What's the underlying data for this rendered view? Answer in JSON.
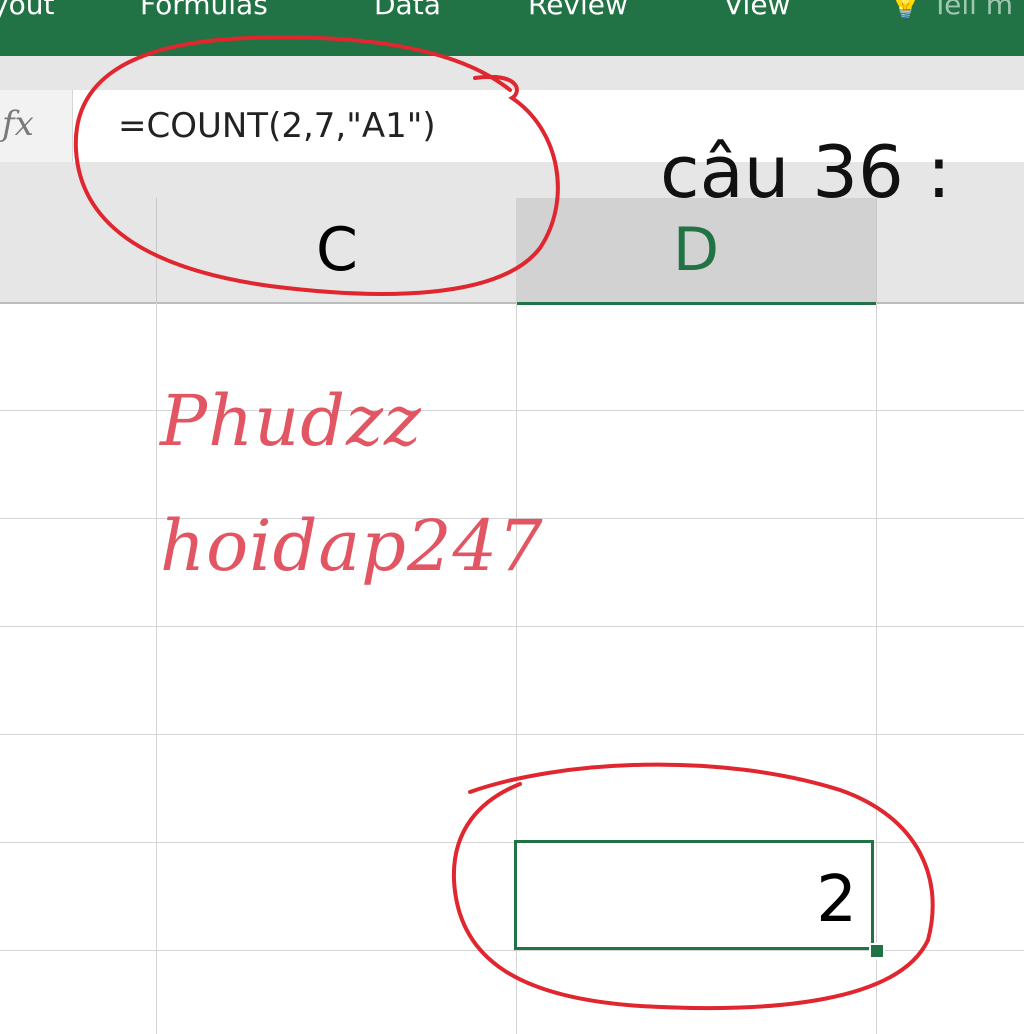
{
  "ribbon": {
    "tabs": [
      "yout",
      "Formulas",
      "Data",
      "Review",
      "View",
      "Tell m"
    ],
    "bg_color": "#217346"
  },
  "formula_bar": {
    "fx_label": "fx",
    "formula": "=COUNT(2,7,\"A1\")"
  },
  "column_headers": {
    "c": "C",
    "d": "D"
  },
  "annotation": {
    "question": "câu 36 :",
    "watermark_line1": "Phudzz",
    "watermark_line2": "hoidap247",
    "circle_color": "#e0262e"
  },
  "active_cell": {
    "value": "2"
  }
}
